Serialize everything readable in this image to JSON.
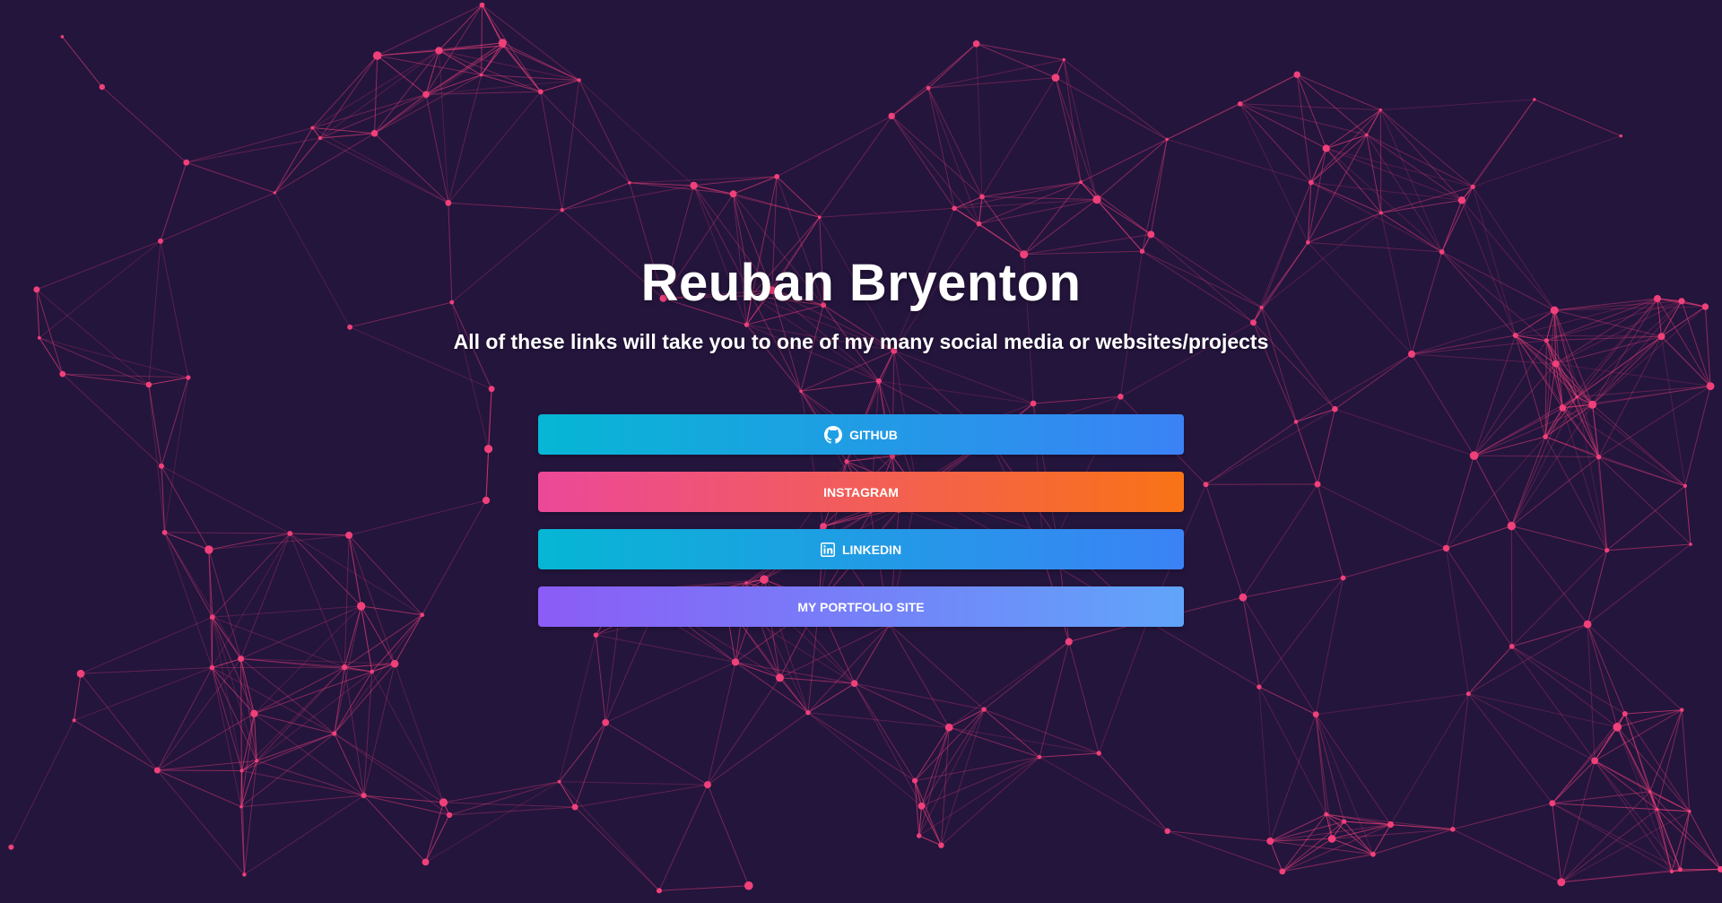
{
  "page": {
    "title": "Reuban Bryenton",
    "subtitle": "All of these links will take you to one of my many social media or websites/projects"
  },
  "links": [
    {
      "label": "GITHUB",
      "icon": "github-icon"
    },
    {
      "label": "INSTAGRAM"
    },
    {
      "label": "LINKEDIN",
      "icon": "linkedin-icon"
    },
    {
      "label": "MY PORTFOLIO SITE"
    }
  ],
  "colors": {
    "background": "#24153d",
    "network": "#f0407a",
    "github_gradient": [
      "#06b6d4",
      "#3b82f6"
    ],
    "instagram_gradient": [
      "#ec4899",
      "#f97316"
    ],
    "linkedin_gradient": [
      "#06b6d4",
      "#3b82f6"
    ],
    "portfolio_gradient": [
      "#8b5cf6",
      "#60a5fa"
    ]
  }
}
